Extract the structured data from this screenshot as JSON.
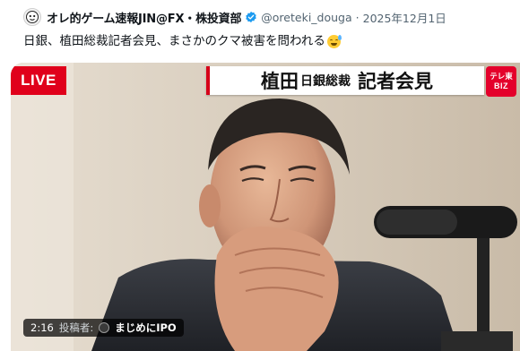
{
  "tweet": {
    "display_name": "オレ的ゲーム速報JIN@FX・株投資部",
    "handle": "@oreteki_douga",
    "separator": "·",
    "date": "2025年12月1日",
    "text": "日銀、植田総裁記者会見、まさかのクマ被害を問われる",
    "emoji": "grinning-face-with-sweat-emoji",
    "avatar_icon": "ghost-face-avatar-icon",
    "verified_icon": "verified-badge-icon"
  },
  "video": {
    "live_label": "LIVE",
    "banner_name": "植田",
    "banner_org": "日銀総裁",
    "banner_event": "記者会見",
    "channel_logo_line1": "テレ東",
    "channel_logo_line2": "BIZ",
    "duration": "2:16",
    "uploader_label": "投稿者:",
    "uploader_name": "まじめにIPO",
    "colors": {
      "live_red": "#e0001b",
      "logo_red": "#e4002b",
      "verified_blue": "#1d9bf0"
    }
  }
}
